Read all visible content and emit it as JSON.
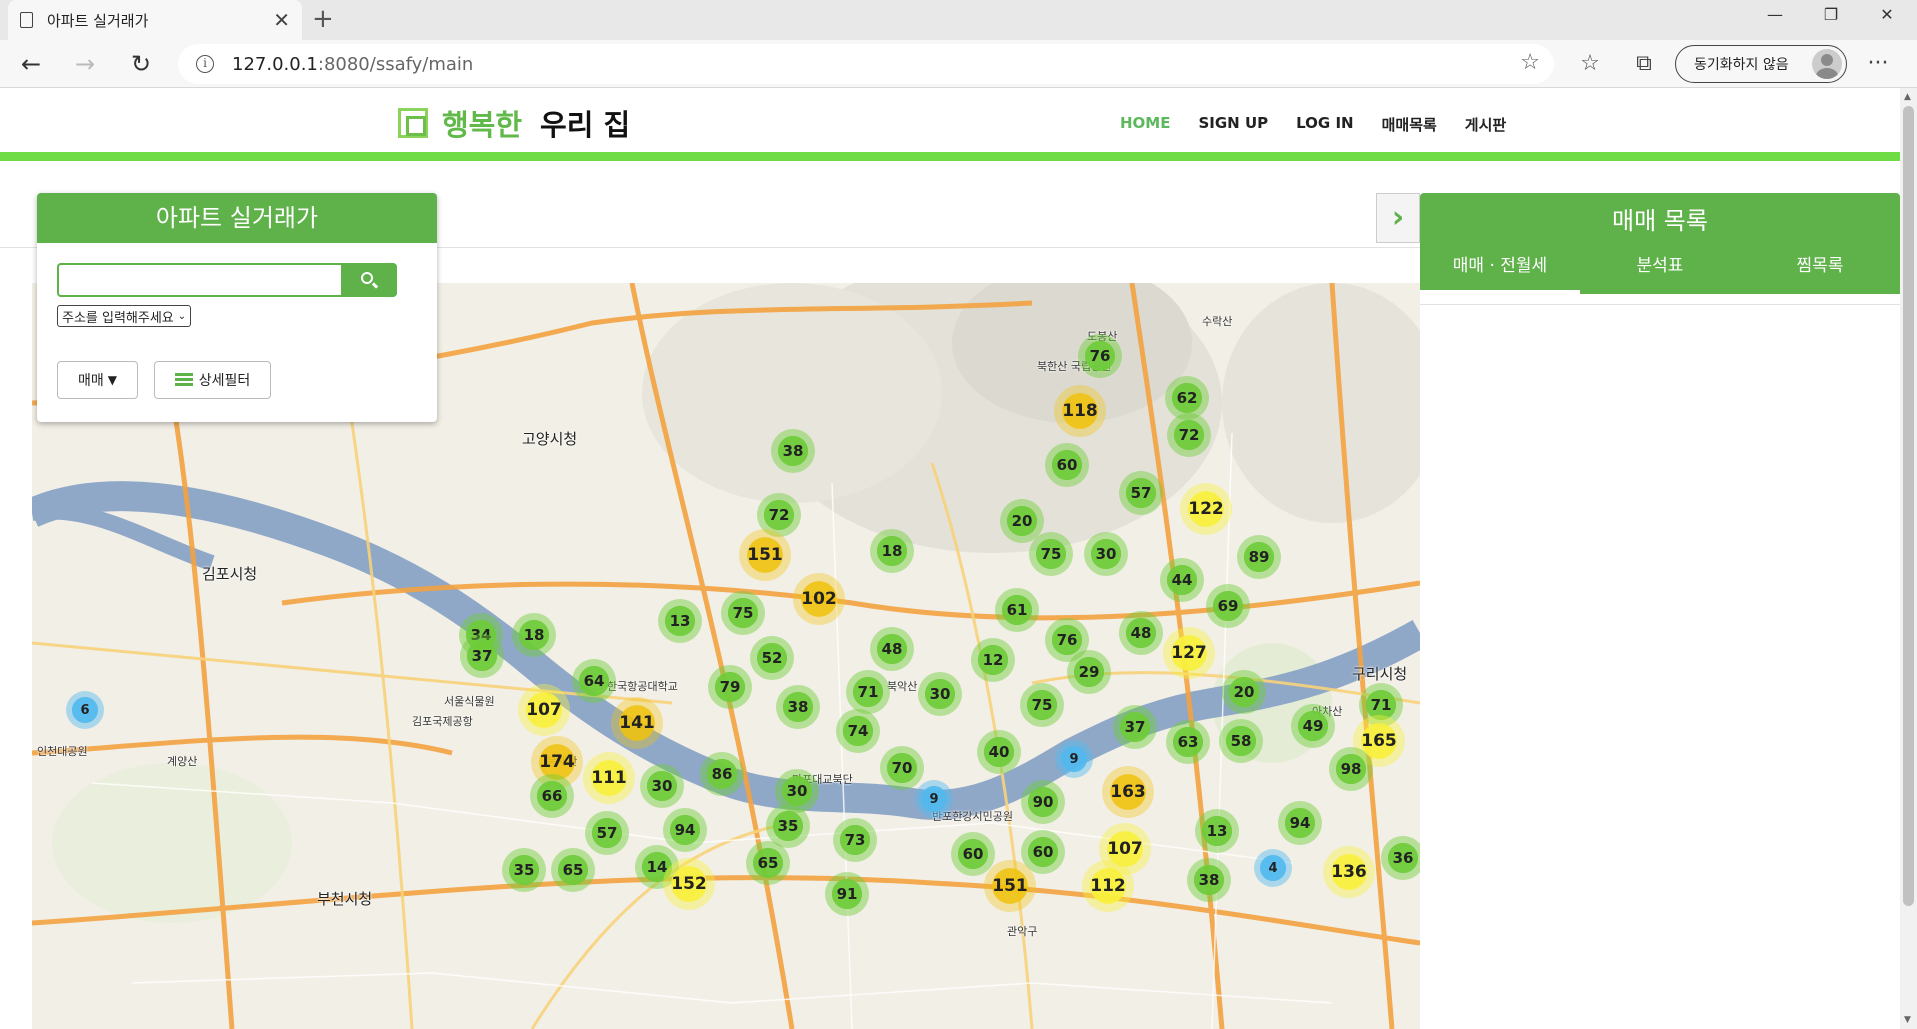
{
  "browser": {
    "tab_title": "아파트 실거래가",
    "tab_close": "✕",
    "new_tab": "+",
    "url_host": "127.0.0.1",
    "url_path": ":8080/ssafy/main",
    "sync_label": "동기화하지 않음",
    "more": "···"
  },
  "header": {
    "brand_accent": "행복한",
    "brand_main": "우리 집",
    "nav": [
      "HOME",
      "SIGN UP",
      "LOG IN",
      "매매목록",
      "게시판"
    ]
  },
  "search_panel": {
    "title": "아파트 실거래가",
    "address_placeholder": "주소를 입력해주세요",
    "trade_button": "매매",
    "trade_arrow": "▼",
    "filter_button": "상세필터"
  },
  "list_panel": {
    "toggle": "›",
    "title": "매매 목록",
    "tabs": [
      "매매 · 전월세",
      "분석표",
      "찜목록"
    ]
  },
  "map": {
    "places": [
      {
        "name": "고양시청",
        "big": true
      },
      {
        "name": "김포시청",
        "big": true
      },
      {
        "name": "부천시청",
        "big": true
      },
      {
        "name": "구리시청",
        "big": true
      },
      {
        "name": "북한산 국립공원",
        "big": false
      },
      {
        "name": "도봉산",
        "big": false
      },
      {
        "name": "수락산",
        "big": false
      },
      {
        "name": "한국항공대학교",
        "big": false
      },
      {
        "name": "김포국제공항",
        "big": false
      },
      {
        "name": "서울식물원",
        "big": false
      },
      {
        "name": "북악산",
        "big": false
      },
      {
        "name": "아차산",
        "big": false
      },
      {
        "name": "마포대교북단",
        "big": false
      },
      {
        "name": "반포한강시민공원",
        "big": false
      },
      {
        "name": "인천대공원",
        "big": false
      },
      {
        "name": "계양산",
        "big": false
      },
      {
        "name": "봉제산",
        "big": false
      },
      {
        "name": "관악구",
        "big": false
      }
    ],
    "clusters": [
      {
        "v": "76",
        "c": "green"
      },
      {
        "v": "62",
        "c": "green"
      },
      {
        "v": "118",
        "c": "yellow"
      },
      {
        "v": "72",
        "c": "green"
      },
      {
        "v": "38",
        "c": "green"
      },
      {
        "v": "60",
        "c": "green"
      },
      {
        "v": "57",
        "c": "green"
      },
      {
        "v": "122",
        "c": "yellow"
      },
      {
        "v": "72",
        "c": "green"
      },
      {
        "v": "20",
        "c": "green"
      },
      {
        "v": "151",
        "c": "yellow"
      },
      {
        "v": "18",
        "c": "green"
      },
      {
        "v": "75",
        "c": "green"
      },
      {
        "v": "30",
        "c": "green"
      },
      {
        "v": "89",
        "c": "green"
      },
      {
        "v": "44",
        "c": "green"
      },
      {
        "v": "102",
        "c": "yellow"
      },
      {
        "v": "69",
        "c": "green"
      },
      {
        "v": "61",
        "c": "green"
      },
      {
        "v": "13",
        "c": "green"
      },
      {
        "v": "75",
        "c": "green"
      },
      {
        "v": "34",
        "c": "green"
      },
      {
        "v": "18",
        "c": "green"
      },
      {
        "v": "37",
        "c": "green"
      },
      {
        "v": "76",
        "c": "green"
      },
      {
        "v": "48",
        "c": "green"
      },
      {
        "v": "48",
        "c": "green"
      },
      {
        "v": "127",
        "c": "yellow"
      },
      {
        "v": "52",
        "c": "green"
      },
      {
        "v": "12",
        "c": "green"
      },
      {
        "v": "29",
        "c": "green"
      },
      {
        "v": "64",
        "c": "green"
      },
      {
        "v": "79",
        "c": "green"
      },
      {
        "v": "71",
        "c": "green"
      },
      {
        "v": "30",
        "c": "green"
      },
      {
        "v": "20",
        "c": "green"
      },
      {
        "v": "6",
        "c": "blue"
      },
      {
        "v": "107",
        "c": "yellow"
      },
      {
        "v": "141",
        "c": "yellow"
      },
      {
        "v": "38",
        "c": "green"
      },
      {
        "v": "74",
        "c": "green"
      },
      {
        "v": "75",
        "c": "green"
      },
      {
        "v": "37",
        "c": "green"
      },
      {
        "v": "71",
        "c": "green"
      },
      {
        "v": "49",
        "c": "green"
      },
      {
        "v": "63",
        "c": "green"
      },
      {
        "v": "58",
        "c": "green"
      },
      {
        "v": "165",
        "c": "yellow"
      },
      {
        "v": "40",
        "c": "green"
      },
      {
        "v": "9",
        "c": "blue"
      },
      {
        "v": "174",
        "c": "yellow"
      },
      {
        "v": "111",
        "c": "yellow"
      },
      {
        "v": "86",
        "c": "green"
      },
      {
        "v": "70",
        "c": "green"
      },
      {
        "v": "98",
        "c": "green"
      },
      {
        "v": "30",
        "c": "green"
      },
      {
        "v": "66",
        "c": "green"
      },
      {
        "v": "30",
        "c": "green"
      },
      {
        "v": "9",
        "c": "blue"
      },
      {
        "v": "90",
        "c": "green"
      },
      {
        "v": "163",
        "c": "yellow"
      },
      {
        "v": "57",
        "c": "green"
      },
      {
        "v": "94",
        "c": "green"
      },
      {
        "v": "35",
        "c": "green"
      },
      {
        "v": "73",
        "c": "green"
      },
      {
        "v": "13",
        "c": "green"
      },
      {
        "v": "94",
        "c": "green"
      },
      {
        "v": "14",
        "c": "green"
      },
      {
        "v": "65",
        "c": "green"
      },
      {
        "v": "60",
        "c": "green"
      },
      {
        "v": "60",
        "c": "green"
      },
      {
        "v": "107",
        "c": "yellow"
      },
      {
        "v": "4",
        "c": "blue"
      },
      {
        "v": "136",
        "c": "yellow"
      },
      {
        "v": "36",
        "c": "green"
      },
      {
        "v": "35",
        "c": "green"
      },
      {
        "v": "65",
        "c": "green"
      },
      {
        "v": "152",
        "c": "yellow"
      },
      {
        "v": "151",
        "c": "yellow"
      },
      {
        "v": "112",
        "c": "yellow"
      },
      {
        "v": "38",
        "c": "green"
      },
      {
        "v": "91",
        "c": "green"
      }
    ]
  },
  "colors": {
    "brand_green": "#5fb14a",
    "bar_green": "#6fdc45",
    "cluster_green": "#6ecc39",
    "cluster_yellow": "#f0c20c",
    "cluster_blue": "#51b9ef",
    "river": "#8aa4c4"
  }
}
